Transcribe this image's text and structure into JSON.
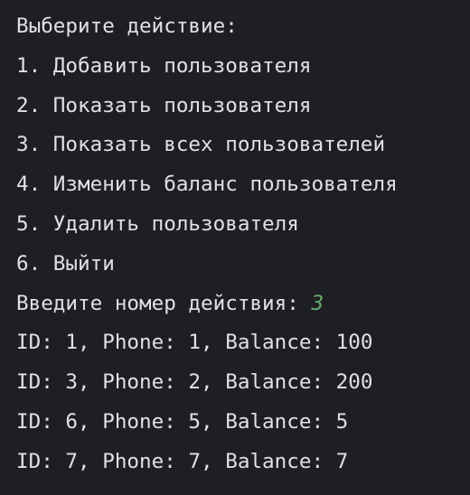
{
  "terminal": {
    "menu_title": "Выберите действие:",
    "menu_items": [
      "1. Добавить пользователя",
      "2. Показать пользователя",
      "3. Показать всех пользователей",
      "4. Изменить баланс пользователя",
      "5. Удалить пользователя",
      "6. Выйти"
    ],
    "prompt": "Введите номер действия: ",
    "user_input": "3",
    "output_lines": [
      "ID: 1, Phone: 1, Balance: 100",
      "ID: 3, Phone: 2, Balance: 200",
      "ID: 6, Phone: 5, Balance: 5",
      "ID: 7, Phone: 7, Balance: 7"
    ],
    "colors": {
      "background": "#1e1f22",
      "text": "#dfe1e5",
      "input": "#6aab73"
    }
  }
}
